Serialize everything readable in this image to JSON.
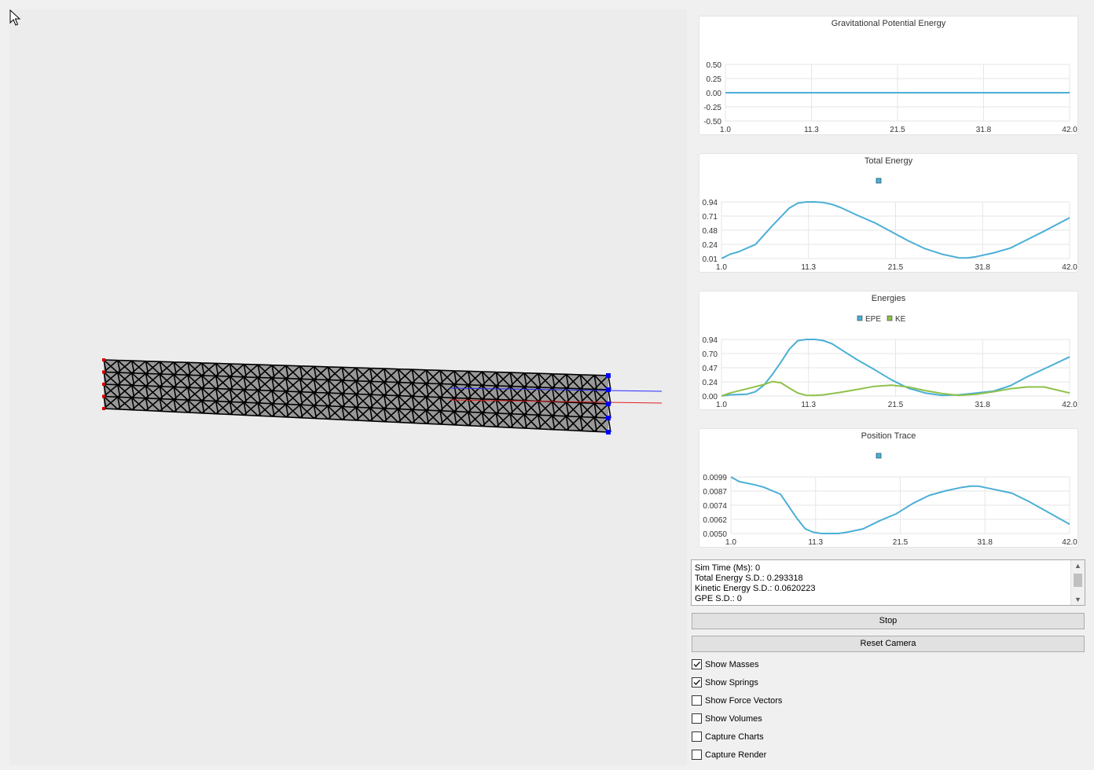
{
  "charts": [
    {
      "title": "Gravitational Potential Energy",
      "legend": [],
      "y_ticks": [
        "0.50",
        "0.25",
        "0.00",
        "-0.25",
        "-0.50"
      ],
      "x_ticks": [
        "1.0",
        "11.3",
        "21.5",
        "31.8",
        "42.0"
      ]
    },
    {
      "title": "Total Energy",
      "legend": [
        {
          "label": ""
        }
      ],
      "y_ticks": [
        "0.94",
        "0.71",
        "0.48",
        "0.24",
        "0.01"
      ],
      "x_ticks": [
        "1.0",
        "11.3",
        "21.5",
        "31.8",
        "42.0"
      ]
    },
    {
      "title": "Energies",
      "legend": [
        {
          "label": "EPE"
        },
        {
          "label": "KE"
        }
      ],
      "y_ticks": [
        "0.94",
        "0.70",
        "0.47",
        "0.24",
        "0.00"
      ],
      "x_ticks": [
        "1.0",
        "11.3",
        "21.5",
        "31.8",
        "42.0"
      ]
    },
    {
      "title": "Position Trace",
      "legend": [
        {
          "label": ""
        }
      ],
      "y_ticks": [
        "0.0099",
        "0.0087",
        "0.0074",
        "0.0062",
        "0.0050"
      ],
      "x_ticks": [
        "1.0",
        "11.3",
        "21.5",
        "31.8",
        "42.0"
      ]
    }
  ],
  "chart_data": [
    {
      "type": "line",
      "title": "Gravitational Potential Energy",
      "xlim": [
        1.0,
        42.0
      ],
      "ylim": [
        -0.5,
        0.5
      ],
      "grid": true,
      "series": [
        {
          "color": "#4bafd6",
          "x": [
            1,
            42
          ],
          "y": [
            0,
            0
          ]
        }
      ]
    },
    {
      "type": "line",
      "title": "Total Energy",
      "xlim": [
        1.0,
        42.0
      ],
      "ylim": [
        0.01,
        0.94
      ],
      "grid": true,
      "legend": "top-center",
      "series": [
        {
          "color": "#4bafd6",
          "x": [
            1,
            2,
            3,
            5,
            7,
            9,
            10,
            11,
            12,
            13,
            14,
            15,
            17,
            19,
            21,
            23,
            25,
            27,
            29,
            30,
            31,
            33,
            35,
            37,
            39,
            42
          ],
          "y": [
            0.01,
            0.08,
            0.12,
            0.24,
            0.55,
            0.84,
            0.92,
            0.94,
            0.94,
            0.93,
            0.9,
            0.85,
            0.72,
            0.6,
            0.45,
            0.3,
            0.17,
            0.08,
            0.02,
            0.02,
            0.04,
            0.1,
            0.18,
            0.32,
            0.46,
            0.68
          ]
        }
      ]
    },
    {
      "type": "line",
      "title": "Energies",
      "xlim": [
        1.0,
        42.0
      ],
      "ylim": [
        0.0,
        0.94
      ],
      "grid": true,
      "legend": "top-center",
      "series": [
        {
          "name": "EPE",
          "color": "#4bafd6",
          "x": [
            1,
            2,
            4,
            5,
            6,
            7,
            8,
            9,
            10,
            11,
            12,
            13,
            14,
            15,
            17,
            19,
            21,
            23,
            25,
            27,
            29,
            31,
            33,
            35,
            37,
            39,
            42
          ],
          "y": [
            0.0,
            0.02,
            0.03,
            0.07,
            0.18,
            0.36,
            0.56,
            0.78,
            0.92,
            0.94,
            0.94,
            0.92,
            0.87,
            0.78,
            0.6,
            0.44,
            0.27,
            0.13,
            0.05,
            0.01,
            0.02,
            0.05,
            0.08,
            0.17,
            0.32,
            0.45,
            0.65
          ]
        },
        {
          "name": "KE",
          "color": "#8fc14a",
          "x": [
            1,
            2,
            4,
            6,
            7,
            8,
            9,
            10,
            11,
            12,
            13,
            15,
            17,
            19,
            21,
            23,
            25,
            27,
            29,
            31,
            33,
            35,
            37,
            39,
            42
          ],
          "y": [
            0.0,
            0.05,
            0.12,
            0.19,
            0.24,
            0.22,
            0.13,
            0.05,
            0.01,
            0.01,
            0.02,
            0.06,
            0.11,
            0.16,
            0.18,
            0.15,
            0.09,
            0.04,
            0.01,
            0.03,
            0.07,
            0.12,
            0.15,
            0.15,
            0.05
          ]
        }
      ]
    },
    {
      "type": "line",
      "title": "Position Trace",
      "xlim": [
        1.0,
        42.0
      ],
      "ylim": [
        0.005,
        0.0099
      ],
      "grid": true,
      "legend": "top-center",
      "series": [
        {
          "color": "#4bafd6",
          "x": [
            1,
            2,
            4,
            5,
            7,
            9,
            10,
            11,
            12,
            13,
            14,
            15,
            17,
            19,
            21,
            23,
            25,
            27,
            29,
            30,
            31,
            33,
            35,
            37,
            39,
            42
          ],
          "y": [
            0.0099,
            0.0095,
            0.0092,
            0.009,
            0.0084,
            0.0063,
            0.0054,
            0.0051,
            0.005,
            0.005,
            0.005,
            0.0051,
            0.0054,
            0.0061,
            0.0067,
            0.0076,
            0.0083,
            0.0087,
            0.009,
            0.0091,
            0.0091,
            0.0088,
            0.0085,
            0.0078,
            0.007,
            0.0058
          ]
        }
      ]
    }
  ],
  "log": {
    "lines": [
      "Sim Time (Ms): 0",
      "Total Energy S.D.: 0.293318",
      "Kinetic Energy S.D.: 0.0620223",
      "GPE S.D.: 0"
    ]
  },
  "buttons": {
    "stop": "Stop",
    "reset_camera": "Reset Camera"
  },
  "checkboxes": [
    {
      "label": "Show Masses",
      "checked": true
    },
    {
      "label": "Show Springs",
      "checked": true
    },
    {
      "label": "Show Force Vectors",
      "checked": false
    },
    {
      "label": "Show Volumes",
      "checked": false
    },
    {
      "label": "Capture Charts",
      "checked": false
    },
    {
      "label": "Capture Render",
      "checked": false
    }
  ],
  "colors": {
    "series_blue": "#4bafd6",
    "series_green": "#8fc14a",
    "fixed_mass": "#d00000",
    "free_mass": "#0000ff",
    "spring": "#000000"
  },
  "icons": [
    "arrow-cursor-icon",
    "check-icon",
    "chevron-up-icon",
    "chevron-down-icon"
  ]
}
